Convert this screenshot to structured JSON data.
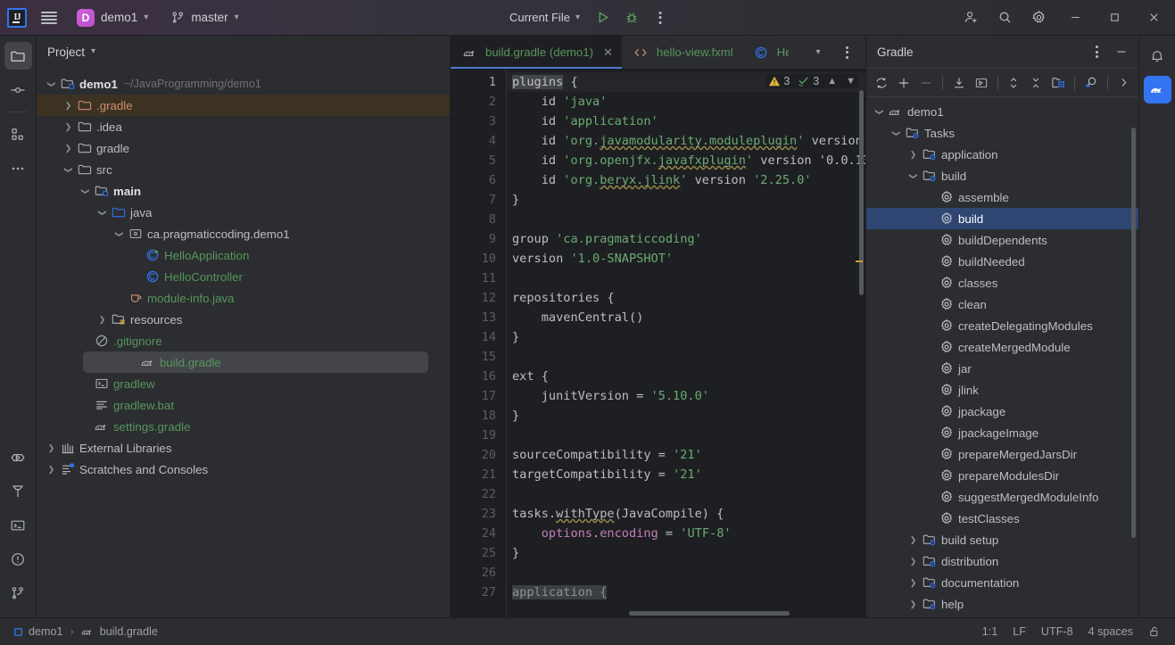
{
  "titlebar": {
    "app_icon": "intellij-logo-icon",
    "menu_icon": "hamburger-menu-icon",
    "project_initial": "D",
    "project_name": "demo1",
    "branch_icon": "git-branch-icon",
    "branch_name": "master",
    "run_config": "Current File",
    "run_icon": "run-icon",
    "debug_icon": "debug-icon",
    "more_icon": "more-vertical-icon",
    "add_user_icon": "add-user-icon",
    "search_icon": "search-icon",
    "settings_icon": "gear-icon",
    "minimize_icon": "minimize-icon",
    "maximize_icon": "maximize-icon",
    "close_icon": "close-icon"
  },
  "left_strip": {
    "items": [
      {
        "name": "project-tool-icon",
        "active": true
      },
      {
        "name": "commit-tool-icon",
        "active": false
      },
      {
        "name": "structure-tool-icon",
        "active": false
      },
      {
        "name": "more-tools-icon",
        "active": false
      }
    ],
    "bottom_items": [
      {
        "name": "run-tool-icon"
      },
      {
        "name": "build-tool-icon"
      },
      {
        "name": "terminal-tool-icon"
      },
      {
        "name": "problems-tool-icon"
      },
      {
        "name": "version-control-tool-icon"
      }
    ]
  },
  "project_panel": {
    "title": "Project",
    "title_chevron": "chevron-down-icon",
    "tree": [
      {
        "label": "demo1",
        "sub": "~/JavaProgramming/demo1",
        "depth": 0,
        "arrow": "down",
        "icon": "module-folder-icon",
        "style": "bold",
        "state": "normal"
      },
      {
        "label": ".gradle",
        "sub": "",
        "depth": 1,
        "arrow": "right",
        "icon": "excluded-folder-icon",
        "style": "orange",
        "state": "highlight-orange"
      },
      {
        "label": ".idea",
        "sub": "",
        "depth": 1,
        "arrow": "right",
        "icon": "folder-icon",
        "style": "normal",
        "state": "normal"
      },
      {
        "label": "gradle",
        "sub": "",
        "depth": 1,
        "arrow": "right",
        "icon": "folder-icon",
        "style": "normal",
        "state": "normal"
      },
      {
        "label": "src",
        "sub": "",
        "depth": 1,
        "arrow": "down",
        "icon": "folder-icon",
        "style": "normal",
        "state": "normal"
      },
      {
        "label": "main",
        "sub": "",
        "depth": 2,
        "arrow": "down",
        "icon": "module-folder-icon",
        "style": "bold",
        "state": "normal"
      },
      {
        "label": "java",
        "sub": "",
        "depth": 3,
        "arrow": "down",
        "icon": "source-folder-icon",
        "style": "normal",
        "state": "normal"
      },
      {
        "label": "ca.pragmaticcoding.demo1",
        "sub": "",
        "depth": 4,
        "arrow": "down",
        "icon": "package-icon",
        "style": "normal",
        "state": "normal"
      },
      {
        "label": "HelloApplication",
        "sub": "",
        "depth": 5,
        "arrow": "none",
        "icon": "java-class-run-icon",
        "style": "green",
        "state": "normal"
      },
      {
        "label": "HelloController",
        "sub": "",
        "depth": 5,
        "arrow": "none",
        "icon": "java-class-icon",
        "style": "green",
        "state": "normal"
      },
      {
        "label": "module-info.java",
        "sub": "",
        "depth": 4,
        "arrow": "none",
        "icon": "java-file-icon",
        "style": "green",
        "state": "normal"
      },
      {
        "label": "resources",
        "sub": "",
        "depth": 3,
        "arrow": "right",
        "icon": "resource-folder-icon",
        "style": "normal",
        "state": "normal"
      },
      {
        "label": ".gitignore",
        "sub": "",
        "depth": 2,
        "arrow": "none",
        "icon": "gitignore-icon",
        "style": "green",
        "state": "normal"
      },
      {
        "label": "build.gradle",
        "sub": "",
        "depth": 2,
        "arrow": "none",
        "icon": "gradle-file-icon",
        "style": "green",
        "state": "selected"
      },
      {
        "label": "gradlew",
        "sub": "",
        "depth": 2,
        "arrow": "none",
        "icon": "shell-script-icon",
        "style": "green",
        "state": "normal"
      },
      {
        "label": "gradlew.bat",
        "sub": "",
        "depth": 2,
        "arrow": "none",
        "icon": "text-file-icon",
        "style": "green",
        "state": "normal"
      },
      {
        "label": "settings.gradle",
        "sub": "",
        "depth": 2,
        "arrow": "none",
        "icon": "gradle-file-icon",
        "style": "green",
        "state": "normal"
      },
      {
        "label": "External Libraries",
        "sub": "",
        "depth": 0,
        "arrow": "right",
        "icon": "libraries-icon",
        "style": "normal",
        "state": "normal"
      },
      {
        "label": "Scratches and Consoles",
        "sub": "",
        "depth": 0,
        "arrow": "right",
        "icon": "scratches-icon",
        "style": "normal",
        "state": "normal"
      }
    ]
  },
  "editor": {
    "tabs": [
      {
        "label": "build.gradle (demo1)",
        "icon": "gradle-file-icon",
        "active": true,
        "closable": true,
        "color": "green"
      },
      {
        "label": "hello-view.fxml",
        "icon": "fxml-file-icon",
        "active": false,
        "closable": false,
        "color": "green"
      },
      {
        "label": "He",
        "icon": "java-class-icon",
        "active": false,
        "closable": false,
        "color": "green",
        "truncated": true
      }
    ],
    "tab_list_icon": "chevron-down-icon",
    "tab_options_icon": "more-vertical-icon",
    "inspections": {
      "warning_icon": "warning-triangle-icon",
      "warning_count": "3",
      "check_icon": "inspection-check-icon",
      "check_count": "3",
      "prev_icon": "chevron-up-icon",
      "next_icon": "chevron-down-icon"
    },
    "first_line": 1,
    "lines": [
      {
        "n": 1,
        "text": "plugins {",
        "hl": "plugins"
      },
      {
        "n": 2,
        "text": "    id 'java'"
      },
      {
        "n": 3,
        "text": "    id 'application'"
      },
      {
        "n": 4,
        "text": "    id 'org.javamodularity.moduleplugin' version"
      },
      {
        "n": 5,
        "text": "    id 'org.openjfx.javafxplugin' version '0.0.13"
      },
      {
        "n": 6,
        "text": "    id 'org.beryx.jlink' version '2.25.0'"
      },
      {
        "n": 7,
        "text": "}"
      },
      {
        "n": 8,
        "text": ""
      },
      {
        "n": 9,
        "text": "group 'ca.pragmaticcoding'"
      },
      {
        "n": 10,
        "text": "version '1.0-SNAPSHOT'"
      },
      {
        "n": 11,
        "text": ""
      },
      {
        "n": 12,
        "text": "repositories {"
      },
      {
        "n": 13,
        "text": "    mavenCentral()"
      },
      {
        "n": 14,
        "text": "}"
      },
      {
        "n": 15,
        "text": ""
      },
      {
        "n": 16,
        "text": "ext {"
      },
      {
        "n": 17,
        "text": "    junitVersion = '5.10.0'"
      },
      {
        "n": 18,
        "text": "}"
      },
      {
        "n": 19,
        "text": ""
      },
      {
        "n": 20,
        "text": "sourceCompatibility = '21'"
      },
      {
        "n": 21,
        "text": "targetCompatibility = '21'"
      },
      {
        "n": 22,
        "text": ""
      },
      {
        "n": 23,
        "text": "tasks.withType(JavaCompile) {"
      },
      {
        "n": 24,
        "text": "    options.encoding = 'UTF-8'"
      },
      {
        "n": 25,
        "text": "}"
      },
      {
        "n": 26,
        "text": ""
      },
      {
        "n": 27,
        "text": "application {"
      }
    ]
  },
  "gradle_panel": {
    "title": "Gradle",
    "options_icon": "more-vertical-icon",
    "minimize_icon": "minimize-icon",
    "toolbar": [
      {
        "name": "reload-all-gradle-projects-icon"
      },
      {
        "name": "add-gradle-project-icon"
      },
      {
        "name": "detach-gradle-project-icon"
      },
      {
        "name": "download-sources-icon"
      },
      {
        "name": "execute-gradle-task-icon"
      },
      {
        "name": "expand-collapse-icon"
      },
      {
        "name": "collapse-all-icon"
      },
      {
        "name": "project-structure-icon"
      },
      {
        "name": "find-task-icon"
      },
      {
        "name": "more-toolbar-icon"
      }
    ],
    "tree": [
      {
        "label": "demo1",
        "depth": 0,
        "arrow": "down",
        "icon": "gradle-project-icon",
        "state": "normal"
      },
      {
        "label": "Tasks",
        "depth": 1,
        "arrow": "down",
        "icon": "tasks-folder-icon",
        "state": "normal"
      },
      {
        "label": "application",
        "depth": 2,
        "arrow": "right",
        "icon": "tasks-folder-icon",
        "state": "normal"
      },
      {
        "label": "build",
        "depth": 2,
        "arrow": "down",
        "icon": "tasks-folder-icon",
        "state": "normal"
      },
      {
        "label": "assemble",
        "depth": 3,
        "arrow": "none",
        "icon": "gradle-task-icon",
        "state": "normal"
      },
      {
        "label": "build",
        "depth": 3,
        "arrow": "none",
        "icon": "gradle-task-icon",
        "state": "selected"
      },
      {
        "label": "buildDependents",
        "depth": 3,
        "arrow": "none",
        "icon": "gradle-task-icon",
        "state": "normal"
      },
      {
        "label": "buildNeeded",
        "depth": 3,
        "arrow": "none",
        "icon": "gradle-task-icon",
        "state": "normal"
      },
      {
        "label": "classes",
        "depth": 3,
        "arrow": "none",
        "icon": "gradle-task-icon",
        "state": "normal"
      },
      {
        "label": "clean",
        "depth": 3,
        "arrow": "none",
        "icon": "gradle-task-icon",
        "state": "normal"
      },
      {
        "label": "createDelegatingModules",
        "depth": 3,
        "arrow": "none",
        "icon": "gradle-task-icon",
        "state": "normal"
      },
      {
        "label": "createMergedModule",
        "depth": 3,
        "arrow": "none",
        "icon": "gradle-task-icon",
        "state": "normal"
      },
      {
        "label": "jar",
        "depth": 3,
        "arrow": "none",
        "icon": "gradle-task-icon",
        "state": "normal"
      },
      {
        "label": "jlink",
        "depth": 3,
        "arrow": "none",
        "icon": "gradle-task-icon",
        "state": "normal"
      },
      {
        "label": "jpackage",
        "depth": 3,
        "arrow": "none",
        "icon": "gradle-task-icon",
        "state": "normal"
      },
      {
        "label": "jpackageImage",
        "depth": 3,
        "arrow": "none",
        "icon": "gradle-task-icon",
        "state": "normal"
      },
      {
        "label": "prepareMergedJarsDir",
        "depth": 3,
        "arrow": "none",
        "icon": "gradle-task-icon",
        "state": "normal"
      },
      {
        "label": "prepareModulesDir",
        "depth": 3,
        "arrow": "none",
        "icon": "gradle-task-icon",
        "state": "normal"
      },
      {
        "label": "suggestMergedModuleInfo",
        "depth": 3,
        "arrow": "none",
        "icon": "gradle-task-icon",
        "state": "normal"
      },
      {
        "label": "testClasses",
        "depth": 3,
        "arrow": "none",
        "icon": "gradle-task-icon",
        "state": "normal"
      },
      {
        "label": "build setup",
        "depth": 2,
        "arrow": "right",
        "icon": "tasks-folder-icon",
        "state": "normal"
      },
      {
        "label": "distribution",
        "depth": 2,
        "arrow": "right",
        "icon": "tasks-folder-icon",
        "state": "normal"
      },
      {
        "label": "documentation",
        "depth": 2,
        "arrow": "right",
        "icon": "tasks-folder-icon",
        "state": "normal"
      },
      {
        "label": "help",
        "depth": 2,
        "arrow": "right",
        "icon": "tasks-folder-icon",
        "state": "normal"
      }
    ]
  },
  "right_strip": {
    "items": [
      {
        "name": "notifications-bell-icon",
        "active": false
      },
      {
        "name": "gradle-tool-icon",
        "active": true
      }
    ]
  },
  "status_bar": {
    "breadcrumb_project_icon": "module-square-icon",
    "breadcrumb_project": "demo1",
    "breadcrumb_separator": "›",
    "breadcrumb_file_icon": "gradle-file-icon",
    "breadcrumb_file": "build.gradle",
    "caret": "1:1",
    "line_separator": "LF",
    "encoding": "UTF-8",
    "indent": "4 spaces",
    "lock_icon": "unlocked-icon"
  },
  "colors": {
    "background": "#2b2d30",
    "editor_background": "#1e1f22",
    "accent_blue": "#3574f0",
    "selection_blue": "#2f4673",
    "string_green": "#6aab73",
    "file_green": "#57965c",
    "excluded_orange": "#cf8e6d",
    "warning_yellow": "#e3b341",
    "tab_underline": "#4d78cc"
  }
}
